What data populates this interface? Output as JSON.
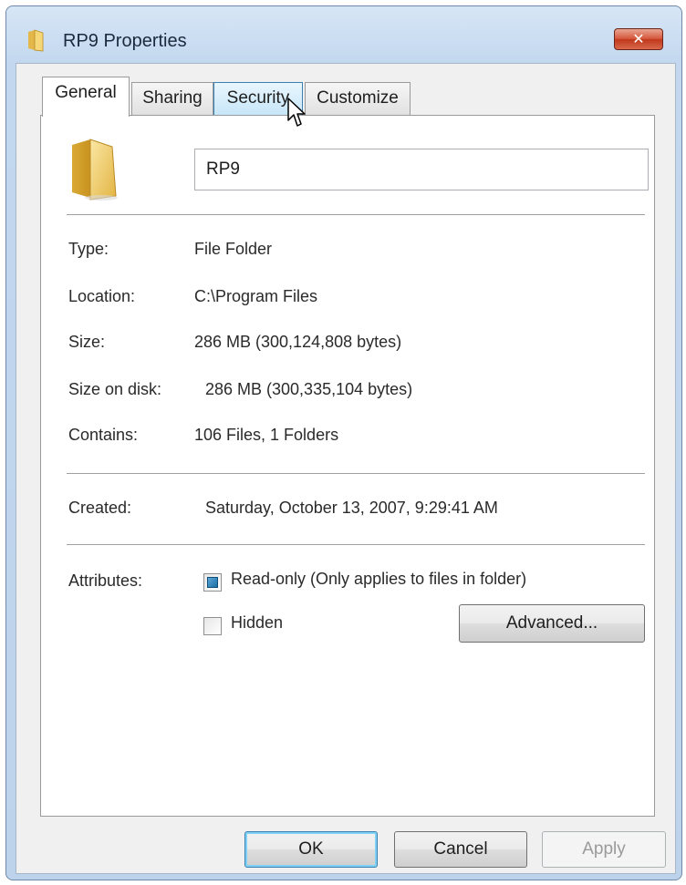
{
  "window": {
    "title": "RP9 Properties",
    "close_glyph": "✕"
  },
  "tabs": [
    {
      "label": "General",
      "state": "active"
    },
    {
      "label": "Sharing",
      "state": "normal"
    },
    {
      "label": "Security",
      "state": "hover"
    },
    {
      "label": "Customize",
      "state": "normal"
    }
  ],
  "general": {
    "folder_name": "RP9",
    "fields": [
      {
        "label": "Type:",
        "value": "File Folder"
      },
      {
        "label": "Location:",
        "value": "C:\\Program Files"
      },
      {
        "label": "Size:",
        "value": "286 MB (300,124,808 bytes)"
      },
      {
        "label": "Size on disk:",
        "value": "286 MB (300,335,104 bytes)"
      },
      {
        "label": "Contains:",
        "value": "106 Files, 1 Folders"
      },
      {
        "label": "Created:",
        "value": "Saturday, October 13, 2007, 9:29:41 AM"
      }
    ],
    "attributes": {
      "label": "Attributes:",
      "read_only": {
        "label": "Read-only (Only applies to files in folder)",
        "state": "indeterminate"
      },
      "hidden": {
        "label": "Hidden",
        "state": "unchecked"
      },
      "advanced_label": "Advanced..."
    }
  },
  "buttons": {
    "ok": "OK",
    "cancel": "Cancel",
    "apply": "Apply"
  },
  "icons": {
    "title": "folder-icon",
    "large": "folder-large-icon",
    "pointer": "mouse-pointer-icon"
  },
  "colors": {
    "frame": "#c3d8ef",
    "close_red": "#c0381b",
    "checkbox_blue": "#1d6fa5",
    "tab_hover": "#c7e6f8"
  }
}
